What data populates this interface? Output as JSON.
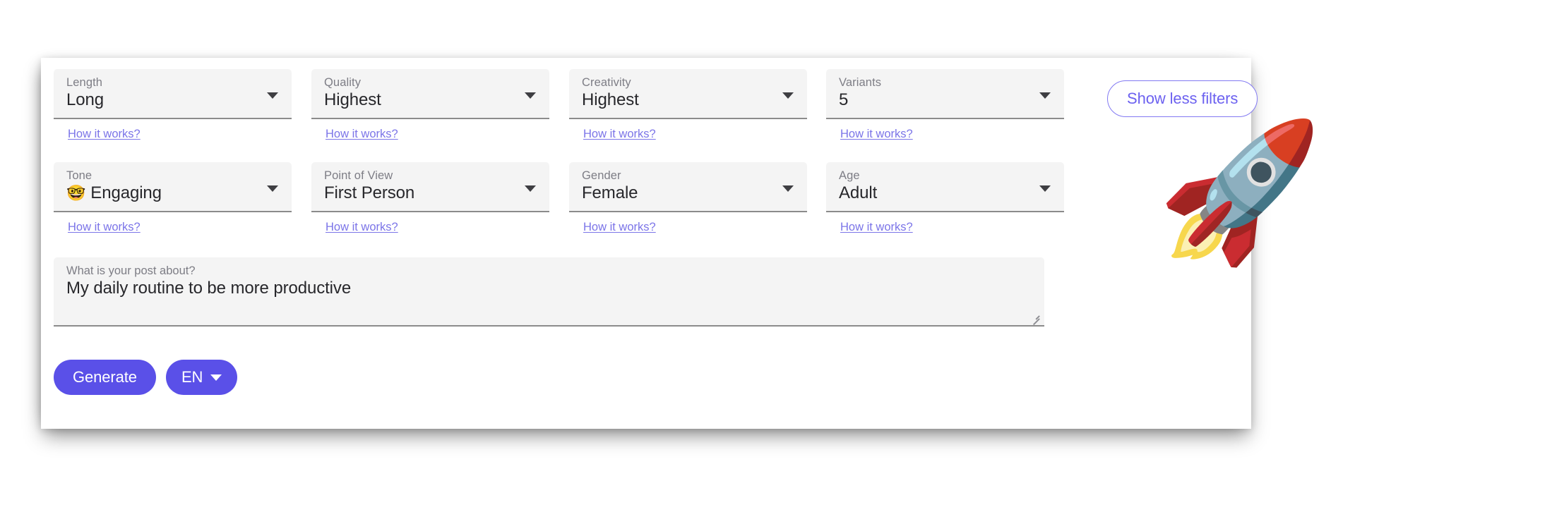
{
  "card": {
    "filters": [
      {
        "name": "length",
        "label": "Length",
        "value": "Long",
        "emoji": "",
        "help": "How it works?",
        "caret": "chevron-down-icon"
      },
      {
        "name": "quality",
        "label": "Quality",
        "value": "Highest",
        "emoji": "",
        "help": "How it works?",
        "caret": "chevron-down-icon"
      },
      {
        "name": "creativity",
        "label": "Creativity",
        "value": "Highest",
        "emoji": "",
        "help": "How it works?",
        "caret": "chevron-down-icon"
      },
      {
        "name": "variants",
        "label": "Variants",
        "value": "5",
        "emoji": "",
        "help": "How it works?",
        "caret": "chevron-down-icon"
      },
      {
        "name": "tone",
        "label": "Tone",
        "value": "Engaging",
        "emoji": "🤓",
        "help": "How it works?",
        "caret": "chevron-down-icon"
      },
      {
        "name": "point-of-view",
        "label": "Point of View",
        "value": "First Person",
        "emoji": "",
        "help": "How it works?",
        "caret": "chevron-down-icon"
      },
      {
        "name": "gender",
        "label": "Gender",
        "value": "Female",
        "emoji": "",
        "help": "How it works?",
        "caret": "chevron-down-icon"
      },
      {
        "name": "age",
        "label": "Age",
        "value": "Adult",
        "emoji": "",
        "help": "How it works?",
        "caret": "chevron-down-icon"
      }
    ],
    "show_less_filters": "Show less filters",
    "prompt": {
      "label": "What is your post about?",
      "value": "My daily routine to be more productive",
      "resize_handle": "resize-grip-icon"
    },
    "actions": {
      "generate": "Generate",
      "language": "EN",
      "language_caret": "chevron-down-icon"
    },
    "decoration": {
      "rocket": "🚀"
    },
    "colors": {
      "accent": "#5a50e8",
      "link": "#7b74e8",
      "outline_button": "#8279f2",
      "field_background": "#f4f4f4",
      "field_underline": "#8b8b8b",
      "label_text": "#7d7d85",
      "value_text": "#27272b",
      "card_background": "#ffffff",
      "page_background": "#ffffff"
    }
  }
}
